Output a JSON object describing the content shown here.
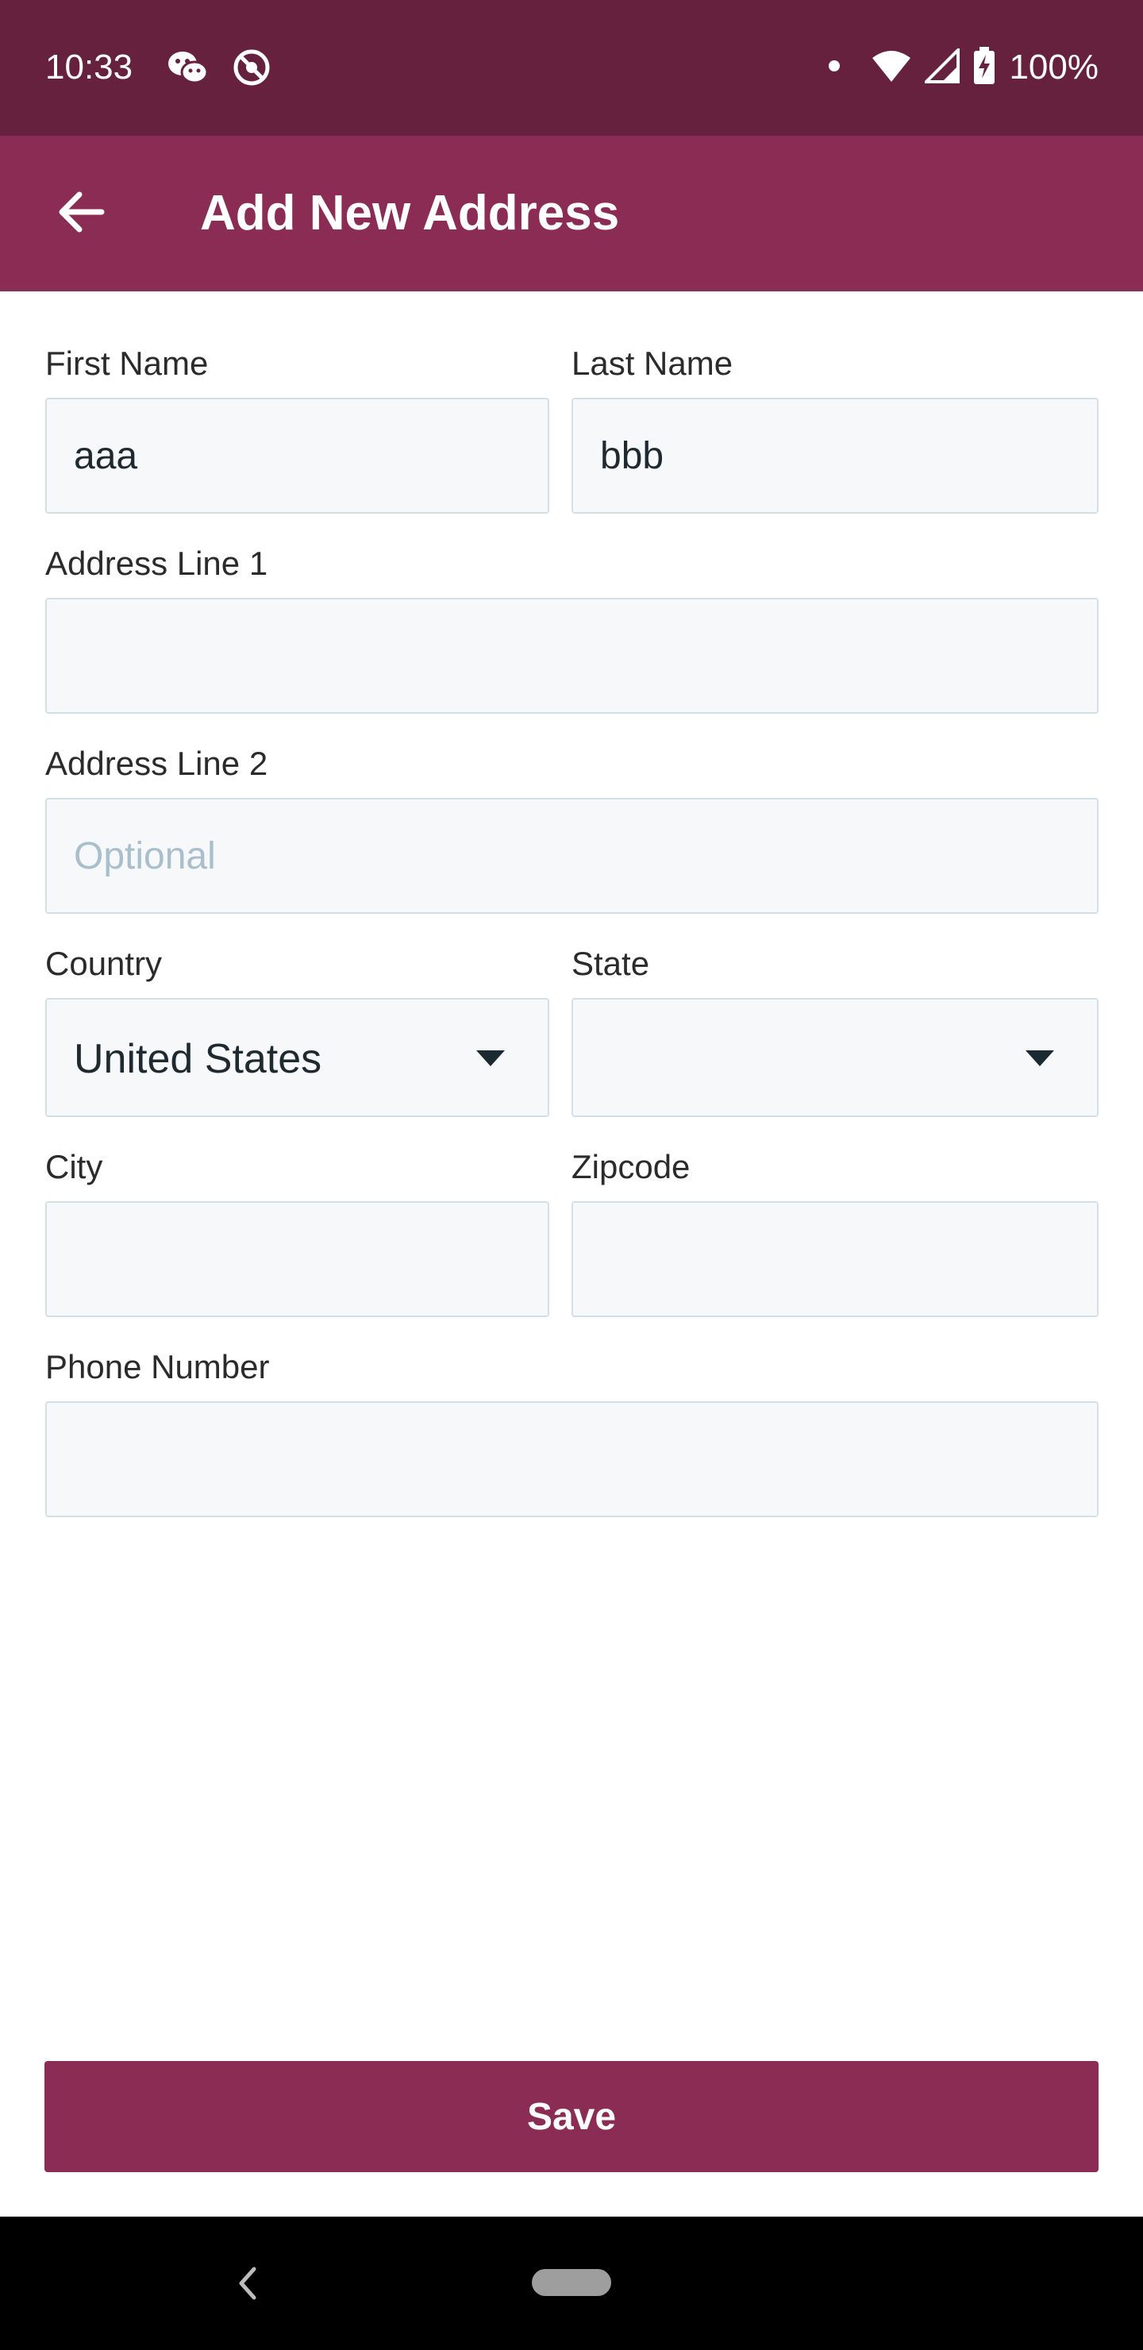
{
  "status_bar": {
    "time": "10:33",
    "battery_percent": "100%",
    "icons": [
      "wechat-icon",
      "vpn-icon",
      "notification-dot-icon",
      "wifi-icon",
      "signal-icon",
      "battery-charging-icon"
    ]
  },
  "app_bar": {
    "title": "Add New Address",
    "back_icon": "arrow-left-icon",
    "background": "#8a2c53"
  },
  "form": {
    "first_name": {
      "label": "First Name",
      "value": "aaa"
    },
    "last_name": {
      "label": "Last Name",
      "value": "bbb"
    },
    "address_line_1": {
      "label": "Address Line 1",
      "value": "",
      "placeholder": ""
    },
    "address_line_2": {
      "label": "Address Line 2",
      "value": "",
      "placeholder": "Optional"
    },
    "country": {
      "label": "Country",
      "selected": "United States"
    },
    "state": {
      "label": "State",
      "selected": ""
    },
    "city": {
      "label": "City",
      "value": ""
    },
    "zipcode": {
      "label": "Zipcode",
      "value": ""
    },
    "phone_number": {
      "label": "Phone Number",
      "value": ""
    }
  },
  "save_button": {
    "label": "Save",
    "color": "#8a2c53"
  },
  "nav_bar": {
    "back_icon": "chevron-left-icon",
    "home_icon": "home-pill-icon"
  }
}
